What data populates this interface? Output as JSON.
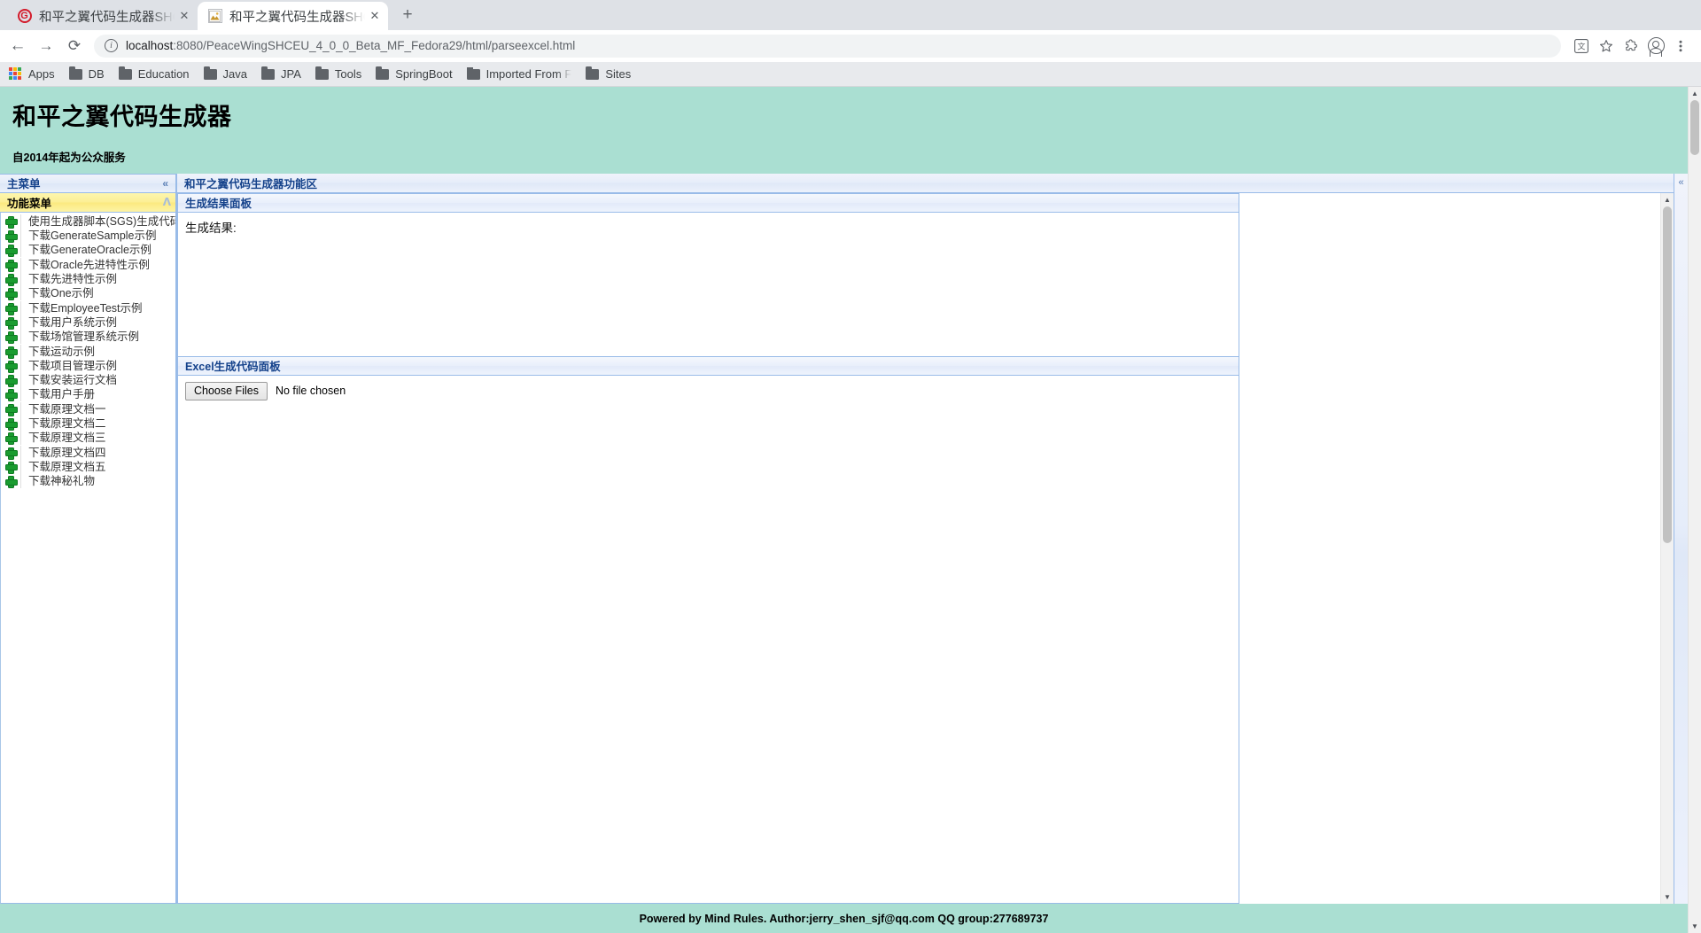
{
  "browser": {
    "tabs": [
      {
        "title": "和平之翼代码生成器SHCE",
        "favicon": "g-circle-icon",
        "active": false
      },
      {
        "title": "和平之翼代码生成器SHCE",
        "favicon": "image-icon",
        "active": true
      }
    ],
    "new_tab_label": "+",
    "close_label": "✕",
    "nav": {
      "back": "←",
      "forward": "→",
      "reload": "⟳"
    },
    "omnibox": {
      "info_icon": "i",
      "host": "localhost",
      "path": ":8080/PeaceWingSHCEU_4_0_0_Beta_MF_Fedora29/html/parseexcel.html"
    },
    "toolbar_icons": [
      {
        "name": "translate-icon",
        "glyph": "文"
      },
      {
        "name": "bookmark-star-icon",
        "glyph": "☆"
      },
      {
        "name": "extension-puzzle-icon",
        "glyph": "🧩"
      },
      {
        "name": "profile-avatar-icon",
        "glyph": ""
      },
      {
        "name": "chrome-menu-icon",
        "glyph": "⋮"
      }
    ],
    "bookmarks": [
      {
        "label": "Apps",
        "icon": "apps-grid-icon"
      },
      {
        "label": "DB",
        "icon": "folder-icon"
      },
      {
        "label": "Education",
        "icon": "folder-icon"
      },
      {
        "label": "Java",
        "icon": "folder-icon"
      },
      {
        "label": "JPA",
        "icon": "folder-icon"
      },
      {
        "label": "Tools",
        "icon": "folder-icon"
      },
      {
        "label": "SpringBoot",
        "icon": "folder-icon"
      },
      {
        "label": "Imported From F",
        "icon": "folder-icon"
      },
      {
        "label": "Sites",
        "icon": "folder-icon"
      }
    ]
  },
  "page": {
    "banner": {
      "title": "和平之翼代码生成器",
      "subtitle": "自2014年起为公众服务"
    },
    "west": {
      "main_menu_title": "主菜单",
      "main_menu_collapse": "«",
      "function_menu_title": "功能菜单",
      "function_menu_collapse": "ᐱ",
      "items": [
        {
          "label": "使用生成器脚本(SGS)生成代码"
        },
        {
          "label": "下载GenerateSample示例"
        },
        {
          "label": "下载GenerateOracle示例"
        },
        {
          "label": "下载Oracle先进特性示例"
        },
        {
          "label": "下载先进特性示例"
        },
        {
          "label": "下载One示例"
        },
        {
          "label": "下载EmployeeTest示例"
        },
        {
          "label": "下载用户系统示例"
        },
        {
          "label": "下载场馆管理系统示例"
        },
        {
          "label": "下载运动示例"
        },
        {
          "label": "下载项目管理示例"
        },
        {
          "label": "下载安装运行文档"
        },
        {
          "label": "下载用户手册"
        },
        {
          "label": "下载原理文档一"
        },
        {
          "label": "下载原理文档二"
        },
        {
          "label": "下载原理文档三"
        },
        {
          "label": "下载原理文档四"
        },
        {
          "label": "下载原理文档五"
        },
        {
          "label": "下载神秘礼物"
        }
      ]
    },
    "center": {
      "title": "和平之翼代码生成器功能区",
      "result_panel": {
        "title": "生成结果面板",
        "result_label": "生成结果:"
      },
      "excel_panel": {
        "title": "Excel生成代码面板",
        "choose_files_label": "Choose Files",
        "file_status": "No file chosen"
      }
    },
    "east": {
      "collapse": "«"
    },
    "footer": {
      "text": "Powered by Mind Rules. Author:jerry_shen_sjf@qq.com QQ group:277689737"
    }
  }
}
